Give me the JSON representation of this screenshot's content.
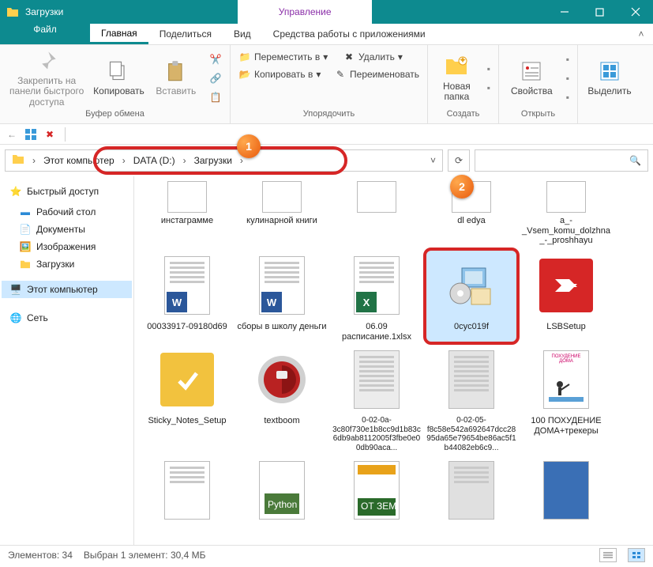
{
  "title": "Загрузки",
  "manage_tab": "Управление",
  "menu": {
    "file": "Файл",
    "home": "Главная",
    "share": "Поделиться",
    "view": "Вид",
    "apps": "Средства работы с приложениями"
  },
  "ribbon": {
    "pin": "Закрепить на панели быстрого доступа",
    "copy": "Копировать",
    "paste": "Вставить",
    "group1": "Буфер обмена",
    "move_to": "Переместить в",
    "copy_to": "Копировать в",
    "delete": "Удалить",
    "rename": "Переименовать",
    "group2": "Упорядочить",
    "new_folder": "Новая папка",
    "group3": "Создать",
    "properties": "Свойства",
    "group4": "Открыть",
    "select": "Выделить"
  },
  "breadcrumb": {
    "root": "Этот компьютер",
    "drive": "DATA (D:)",
    "folder": "Загрузки"
  },
  "nav": {
    "quick": "Быстрый доступ",
    "desktop": "Рабочий стол",
    "documents": "Документы",
    "pictures": "Изображения",
    "downloads": "Загрузки",
    "this_pc": "Этот компьютер",
    "network": "Сеть"
  },
  "files": [
    {
      "name": "инстаграмме"
    },
    {
      "name": "кулинарной книги"
    },
    {
      "name": ""
    },
    {
      "name": "dl     edya"
    },
    {
      "name": "a_-_Vsem_komu_dolzhna_-_proshhayu"
    },
    {
      "name": "00033917-09180d69"
    },
    {
      "name": "сборы в школу деньги"
    },
    {
      "name": "06.09 расписание.1xlsx"
    },
    {
      "name": "0cyc019f"
    },
    {
      "name": "LSBSetup"
    },
    {
      "name": "Sticky_Notes_Setup"
    },
    {
      "name": "textboom"
    },
    {
      "name": "0-02-0a-3c80f730e1b8cc9d1b83c6db9ab8112005f3fbe0e00db90aca..."
    },
    {
      "name": "0-02-05-f8c58e542a692647dcc2895da65e79654be86ac5f1b44082eb6c9..."
    },
    {
      "name": "100 ПОХУДЕНИЕ ДОМА+трекеры"
    }
  ],
  "status": {
    "count": "Элементов: 34",
    "selected": "Выбран 1 элемент: 30,4 МБ"
  },
  "callouts": {
    "one": "1",
    "two": "2"
  }
}
